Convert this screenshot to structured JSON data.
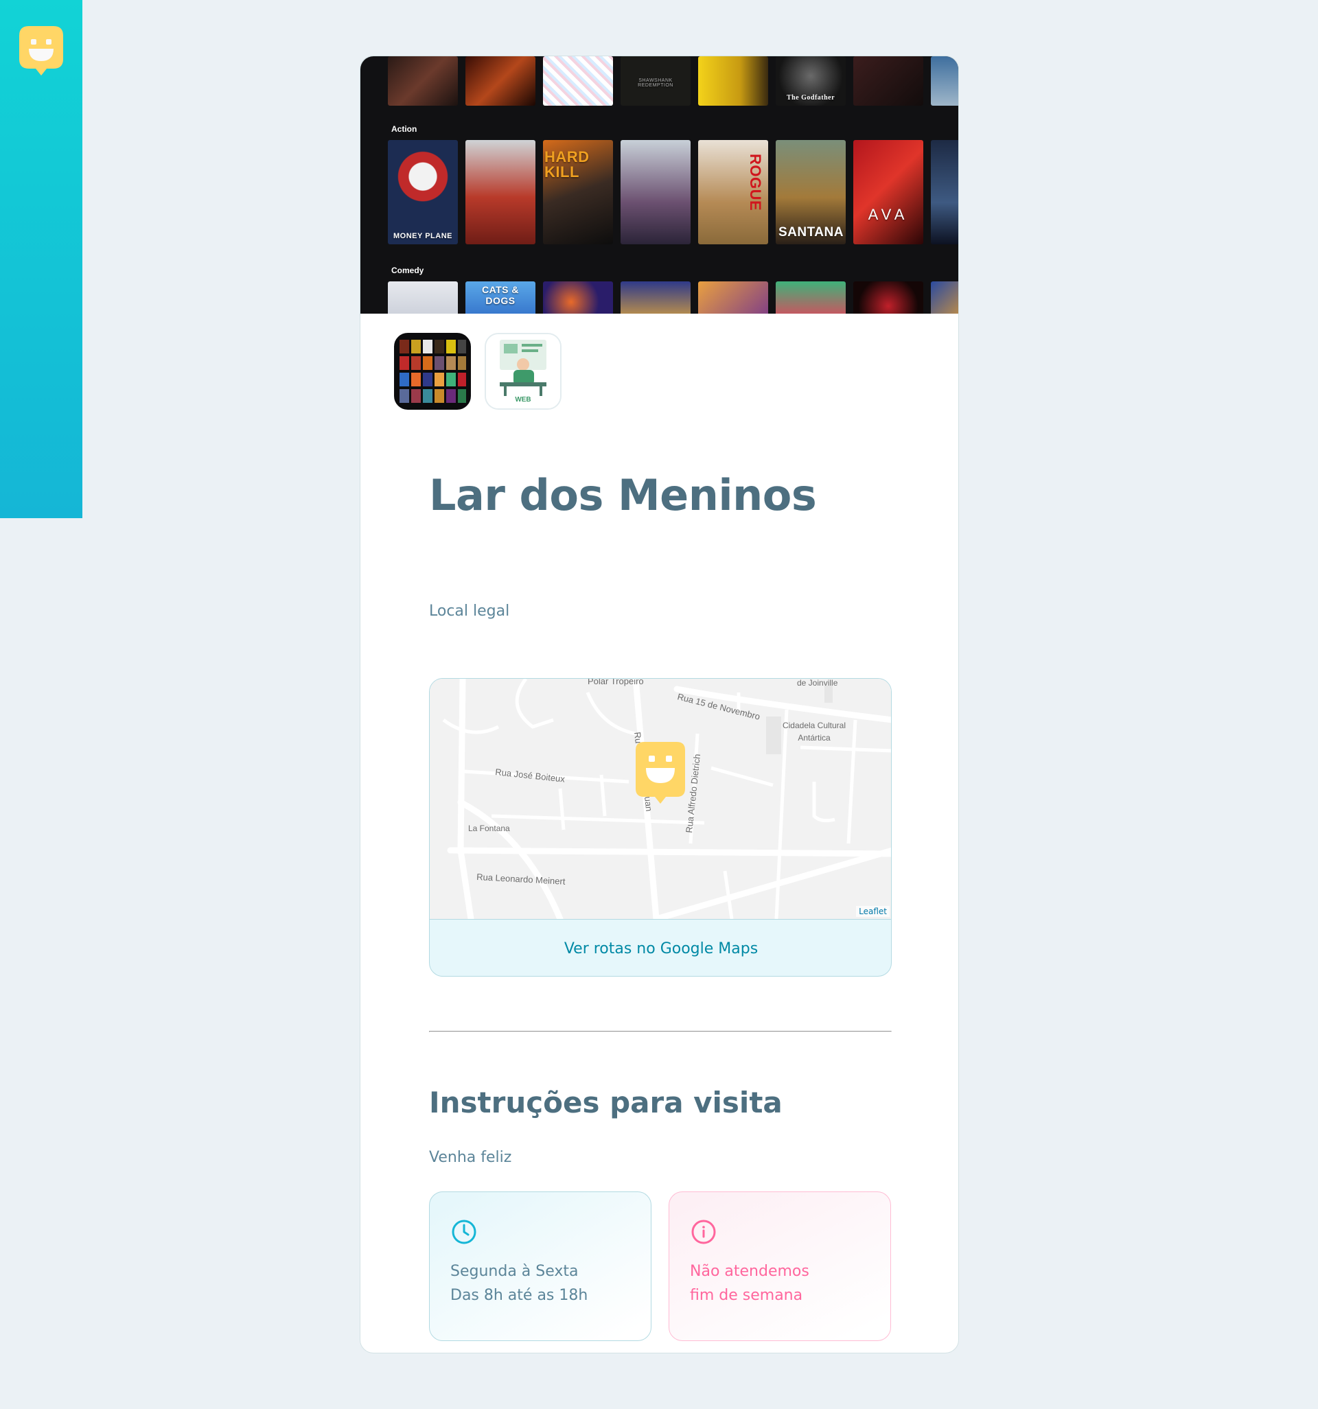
{
  "sidebar": {
    "logo_icon": "smiley-chat-icon",
    "accent": "#12d3d6"
  },
  "hero": {
    "row_labels": [
      "Action",
      "Comedy"
    ],
    "top_row_titles": [
      "",
      "",
      "",
      "SHAWSHANK REDEMPTION",
      "",
      "The Godfather",
      "",
      ""
    ],
    "action_titles": [
      "MONEY PLANE",
      "",
      "HARD KILL",
      "",
      "ROGUE",
      "SANTANA",
      "AVA",
      ""
    ],
    "comedy_titles": [
      "",
      "CATS & DOGS",
      "",
      "",
      "",
      "",
      "",
      ""
    ]
  },
  "place": {
    "name": "Lar dos Meninos",
    "about": "Local legal"
  },
  "map": {
    "streets": [
      "Rua 15 de Novembro",
      "Rua José Boiteux",
      "La Fontana",
      "Rua Leonardo Meinert",
      "Rua Alfredo Dietrich",
      "Cidadela Cultural",
      "Antártica",
      "de Joinville",
      "Polar Tropeiro",
      "Ru",
      "uan"
    ],
    "attribution": "Leaflet",
    "link_label": "Ver rotas no Google Maps",
    "marker_icon": "map-marker-icon"
  },
  "visit": {
    "title": "Instruções para visita",
    "instructions": "Venha feliz",
    "hours_line1": "Segunda à Sexta",
    "hours_line2": "Das 8h até as 18h",
    "weekend_line1": "Não atendemos",
    "weekend_line2": "fim de semana",
    "hours_icon": "clock-icon",
    "info_icon": "info-icon",
    "hours_color": "#15b6d6",
    "weekend_color": "#ff669d"
  }
}
